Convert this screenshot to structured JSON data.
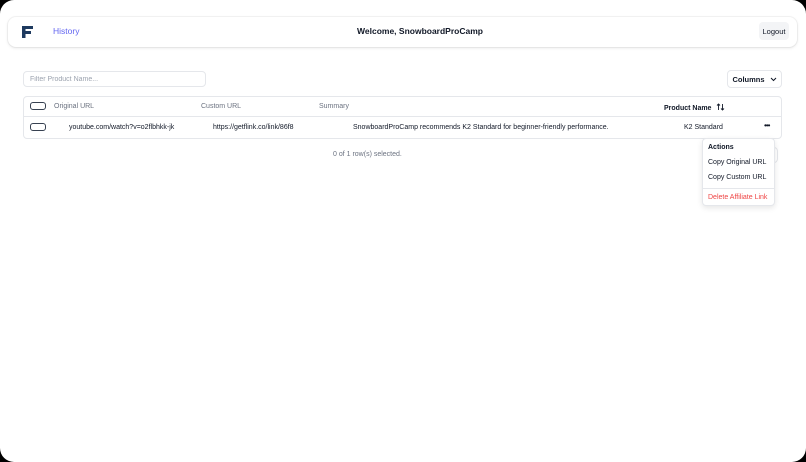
{
  "navbar": {
    "history_label": "History",
    "welcome_text": "Welcome, SnowboardProCamp",
    "logout_label": "Logout"
  },
  "filter": {
    "placeholder": "Filter Product Name..."
  },
  "columns_button": {
    "label": "Columns"
  },
  "table": {
    "headers": {
      "original_url": "Original URL",
      "custom_url": "Custom URL",
      "summary": "Summary",
      "product_name": "Product Name"
    },
    "rows": [
      {
        "original_url": "youtube.com/watch?v=o2flbhkk-jk",
        "custom_url": "https://getflink.co/link/86f8",
        "summary": "SnowboardProCamp recommends K2 Standard for beginner-friendly performance.",
        "product_name": "K2 Standard"
      }
    ]
  },
  "selection_status": "0 of 1 row(s) selected.",
  "actions_menu": {
    "title": "Actions",
    "copy_original": "Copy Original URL",
    "copy_custom": "Copy Custom URL",
    "delete": "Delete Affiliate Link"
  },
  "icons": {
    "logo": "f-logo-icon",
    "sort": "sort-arrows-icon",
    "chevron": "chevron-down-icon",
    "more": "more-horizontal-icon"
  },
  "colors": {
    "accent": "#6366f1",
    "logo": "#1e3a5f",
    "danger": "#ef4444",
    "border": "#e5e7eb"
  }
}
